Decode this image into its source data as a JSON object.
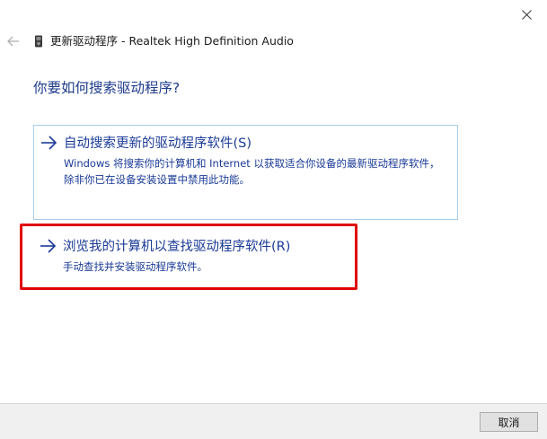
{
  "window": {
    "title": "更新驱动程序 - Realtek High Definition Audio",
    "close_icon": "close-icon",
    "back_icon": "back-arrow-icon",
    "device_icon": "audio-device-icon"
  },
  "main": {
    "heading": "你要如何搜索驱动程序?",
    "options": [
      {
        "title": "自动搜索更新的驱动程序软件(S)",
        "description": "Windows 将搜索你的计算机和 Internet 以获取适合你设备的最新驱动程序软件，除非你已在设备安装设置中禁用此功能。",
        "icon": "arrow-right-icon"
      },
      {
        "title": "浏览我的计算机以查找驱动程序软件(R)",
        "description": "手动查找并安装驱动程序软件。",
        "icon": "arrow-right-icon",
        "highlighted": true
      }
    ]
  },
  "footer": {
    "cancel_label": "取消"
  },
  "colors": {
    "link_blue": "#1a3a96",
    "heading_blue": "#1e3c8c",
    "option_border": "#a6cdec",
    "highlight_red": "#e00000",
    "footer_bg": "#f0f0f0"
  }
}
